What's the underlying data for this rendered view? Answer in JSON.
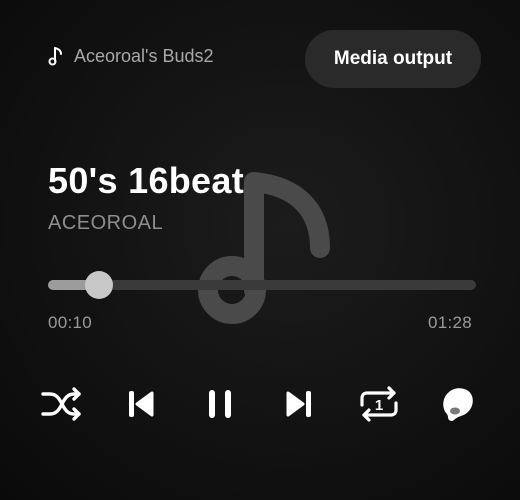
{
  "device": {
    "icon": "music-note-icon",
    "name": "Aceoroal's Buds2"
  },
  "media_output_button": {
    "label": "Media output"
  },
  "track": {
    "title": "50's 16beat",
    "artist": "ACEOROAL",
    "artwork_icon": "music-note-icon"
  },
  "playback": {
    "elapsed": "00:10",
    "total": "01:28",
    "progress_fraction": 0.12
  },
  "controls": {
    "shuffle": "shuffle-icon",
    "previous": "skip-previous-icon",
    "play_pause": "pause-icon",
    "next": "skip-next-icon",
    "repeat": "repeat-one-icon",
    "repeat_digit": "1",
    "audio_effects": "earbud-icon"
  },
  "colors": {
    "background": "#121212",
    "text_primary": "#ffffff",
    "text_secondary": "#8e8e8e",
    "button_bg": "#2a2a2a",
    "track_bg": "#3a3a3a",
    "track_fill": "#9c9c9c",
    "thumb": "#c8c8c8"
  }
}
